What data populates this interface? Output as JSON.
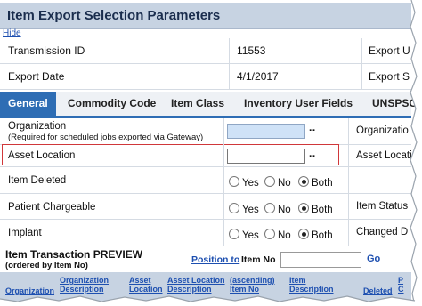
{
  "title": "Item Export Selection Parameters",
  "hide_link": "Hide",
  "info": {
    "transmission_label": "Transmission ID",
    "transmission_value": "11553",
    "export_date_label": "Export Date",
    "export_date_value": "4/1/2017",
    "right_col_label_1": "Export U",
    "right_col_label_2": "Export S"
  },
  "tabs": [
    "General",
    "Commodity Code",
    "Item Class",
    "Inventory User Fields",
    "UNSPSC"
  ],
  "active_tab": "General",
  "form": {
    "organization_label": "Organization",
    "organization_note": "(Required for scheduled jobs exported via Gateway)",
    "organization_right_label": "Organizatio",
    "organization_browse": "...",
    "asset_location_label": "Asset Location",
    "asset_location_right_label": "Asset Locati",
    "asset_location_browse": "...",
    "item_deleted_label": "Item Deleted",
    "patient_chargeable_label": "Patient Chargeable",
    "patient_chargeable_right_label": "Item Status",
    "implant_label": "Implant",
    "implant_right_label": "Changed D",
    "radio_options": [
      "Yes",
      "No",
      "Both"
    ],
    "radio_selected": "Both"
  },
  "preview": {
    "title": "Item Transaction PREVIEW",
    "subtitle": "(ordered by Item No)",
    "position_link": "Position to",
    "position_label": "Item No",
    "position_value": "",
    "go_label": "Go"
  },
  "grid_columns": [
    {
      "label": "Organization",
      "sortable": true
    },
    {
      "label": "Organization Description",
      "sortable": true
    },
    {
      "label": "Asset Location",
      "sortable": true
    },
    {
      "label": "Asset Location Description",
      "sortable": true
    },
    {
      "label": "(ascending) Item No",
      "sortable": true
    },
    {
      "label": "Item Description",
      "sortable": true
    },
    {
      "label": "Deleted",
      "sortable": true
    },
    {
      "label": "P C",
      "sortable": true
    }
  ],
  "colors": {
    "title_bg": "#c7d3e2",
    "tab_active": "#2e6db4",
    "link": "#1d4fb0",
    "highlight_border": "#d0373a",
    "input_bg": "#cfe2f7"
  }
}
